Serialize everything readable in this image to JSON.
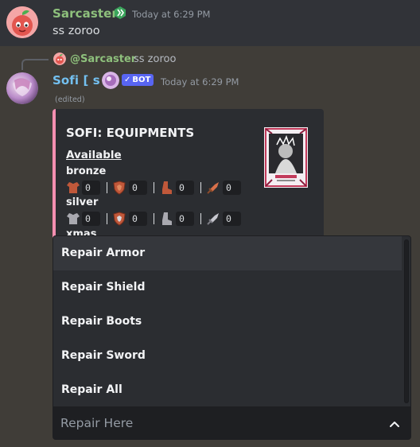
{
  "colors": {
    "sarcaster_name": "#8ec07c",
    "sofi_name": "#73c0f0",
    "embed_accent": "#f48fb1",
    "bot_tag": "#5865f2"
  },
  "message1": {
    "username": "Sarcaster",
    "badge_icon": "hypesquad-icon",
    "timestamp": "Today at 6:29 PM",
    "content": "ss zoroo"
  },
  "message2": {
    "reply": {
      "mention": "@Sarcaster",
      "content": "ss zoroo"
    },
    "username": "Sofi [ s ]",
    "bot_tag": "BOT",
    "timestamp": "Today at 6:29 PM",
    "edited": "(edited)",
    "embed": {
      "title": "SOFI: EQUIPMENTS",
      "section": "Available",
      "tiers": [
        {
          "name": "bronze",
          "counts": [
            "0",
            "0",
            "0",
            "0"
          ]
        },
        {
          "name": "silver",
          "counts": [
            "0",
            "0",
            "0",
            "0"
          ]
        },
        {
          "name": "xmas"
        }
      ],
      "item_icons": [
        "armor-icon",
        "shield-icon",
        "boots-icon",
        "sword-icon"
      ]
    }
  },
  "dropdown": {
    "options": [
      "Repair Armor",
      "Repair Shield",
      "Repair Boots",
      "Repair Sword",
      "Repair All"
    ],
    "placeholder": "Repair Here",
    "chevron_icon": "chevron-up-icon"
  }
}
